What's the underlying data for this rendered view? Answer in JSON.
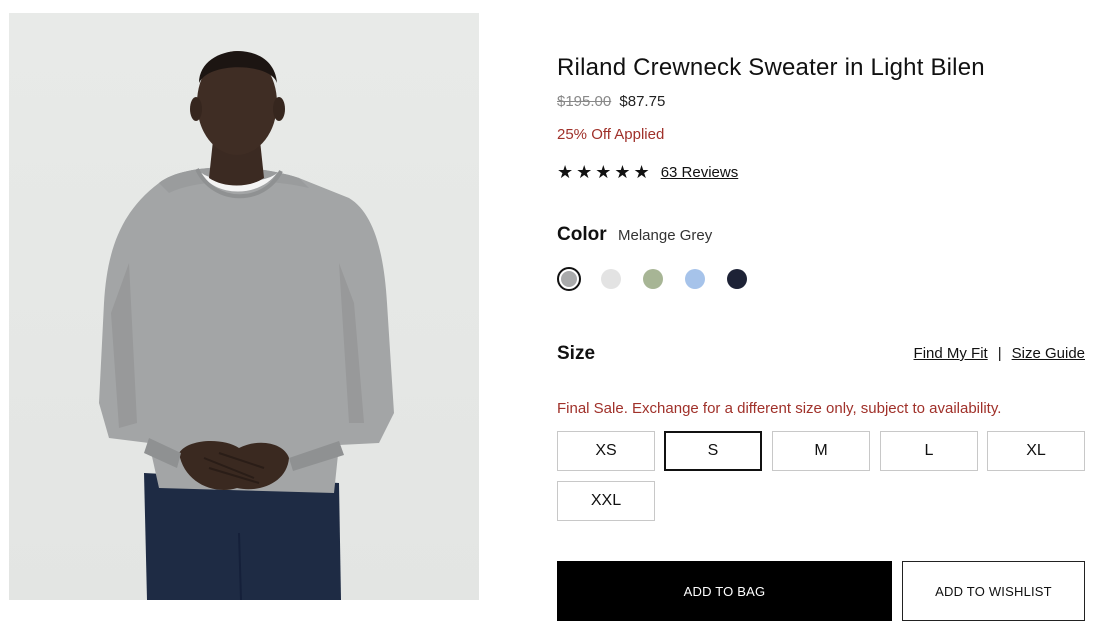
{
  "product": {
    "title": "Riland Crewneck Sweater in Light Bilen",
    "price_original": "$195.00",
    "price_sale": "$87.75",
    "promo": "25% Off Applied",
    "stars": "★★★★★",
    "rating_value": 5,
    "reviews_link": "63 Reviews",
    "image_icon": "product-model-photo"
  },
  "color": {
    "label": "Color",
    "selected_name": "Melange Grey",
    "swatches": [
      {
        "name": "Melange Grey",
        "hex": "#a9aaab",
        "selected": true
      },
      {
        "name": "Light Grey",
        "hex": "#e3e3e3",
        "selected": false
      },
      {
        "name": "Sage",
        "hex": "#a7b595",
        "selected": false
      },
      {
        "name": "Light Blue",
        "hex": "#a6c3ea",
        "selected": false
      },
      {
        "name": "Navy",
        "hex": "#1d2236",
        "selected": false
      }
    ]
  },
  "size": {
    "label": "Size",
    "find_fit": "Find My Fit",
    "separator": "|",
    "size_guide": "Size Guide",
    "final_sale_note": "Final Sale. Exchange for a different size only, subject to availability.",
    "options": [
      "XS",
      "S",
      "M",
      "L",
      "XL",
      "XXL"
    ],
    "selected": "S"
  },
  "actions": {
    "add_to_bag": "ADD TO BAG",
    "add_to_wishlist": "ADD TO WISHLIST"
  },
  "colors": {
    "sale_red": "#a0312a",
    "primary_black": "#000000"
  }
}
